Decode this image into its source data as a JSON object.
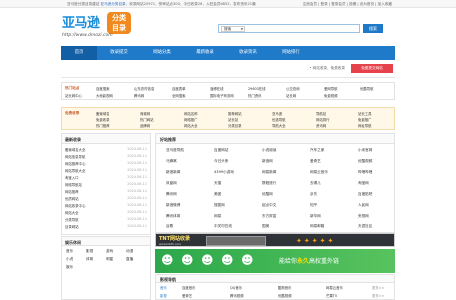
{
  "topbar": {
    "left_pre": "亚马逊分类目录建站",
    "left_hl": "亚马逊分类目录",
    "left_rest": "，收录网站20971，快审站点300，今日收录26，入驻会员6852，发布资讯21篇",
    "right": "注册会员 | 登录 | 登录会员 | 投稿 | 设为首页 | 加入收藏"
  },
  "logo": {
    "name": "亚马逊",
    "badge_top": "分类",
    "badge_bottom": "目录",
    "url": "http://www.dmozi.com"
  },
  "search": {
    "select_value": "搜索",
    "button_label": "搜索"
  },
  "nav": {
    "items": [
      {
        "label": "首页",
        "active": true
      },
      {
        "label": "收录提交",
        "active": false
      },
      {
        "label": "网站分类",
        "active": false
      },
      {
        "label": "最新收录",
        "active": false
      },
      {
        "label": "收录资讯",
        "active": false
      },
      {
        "label": "网站排行",
        "active": false
      }
    ]
  },
  "crumb": {
    "text": "• 网站收录，免费收录",
    "submit_label": "免费提交网站"
  },
  "box1": {
    "label": "热门站点",
    "rows": [
      [
        "百度搜索",
        "山东农村信息",
        "百度表单",
        "淄博在线",
        "29603在线",
        "公交查询",
        "爱网导航",
        "优酷导航"
      ],
      [
        "站长网中心",
        "大地影视网",
        "腾讯网",
        "全网搜索",
        "国际电子商务网",
        "热门资讯",
        "站长网",
        "免费视频"
      ]
    ]
  },
  "box2": {
    "label": "免费收录",
    "rows": [
      [
        "备案域名",
        "商城网",
        "网站名称",
        "推荐网站",
        "亚马逊",
        "导航站",
        "站长工具"
      ],
      [
        "免费收录",
        "热门网站",
        "网络推广",
        "站长站",
        "优选导航",
        "网站排行",
        "免费推广"
      ],
      [
        "热门推荐",
        "品牌网",
        "网站大全",
        "分类目录",
        "导航大全",
        "资讯网",
        "网址导航"
      ]
    ]
  },
  "sidebar": {
    "title": "最新收录",
    "rows": [
      {
        "name": "备案域名大全",
        "date": "2024-06-11"
      },
      {
        "name": "网站信息导航",
        "date": "2024-06-11"
      },
      {
        "name": "网站推荐中心",
        "date": "2024-06-11"
      },
      {
        "name": "网站导航大全",
        "date": "2024-06-11"
      },
      {
        "name": "淘宝入口",
        "date": "2024-06-11"
      },
      {
        "name": "网络导航站",
        "date": "2024-06-11"
      },
      {
        "name": "网站推荐",
        "date": "2024-06-11"
      },
      {
        "name": "优质网站",
        "date": "2024-06-11"
      },
      {
        "name": "网站收录中心",
        "date": "2024-06-11"
      },
      {
        "name": "网站大全",
        "date": "2024-06-11"
      },
      {
        "name": "分类导航",
        "date": "2024-06-11"
      },
      {
        "name": "目录网站",
        "date": "2024-06-11"
      }
    ]
  },
  "sidebar2": {
    "title": "娱乐休闲",
    "cats": [
      "音乐",
      "影视",
      "游戏",
      "动漫",
      "小说",
      "体育",
      "明星",
      "直播",
      "娱乐"
    ]
  },
  "mainbox": {
    "title": "好站推荐",
    "rows": [
      [
        "亚马逊导航",
        "百度网站",
        "小说阅读",
        "汽车之家",
        "小米官网"
      ],
      [
        "马蜂窝",
        "今日头条",
        "新浪网",
        "爱奇艺",
        "优酷视频"
      ],
      [
        "新浪新闻",
        "4399小游戏",
        "网易新闻",
        "网易云音乐",
        "哔哩哔哩"
      ],
      [
        "凤凰网",
        "天猫",
        "携程旅行",
        "去哪儿",
        "淘宝网"
      ],
      [
        "腾讯网",
        "美团",
        "优酷网",
        "京东",
        "百度贴吧"
      ],
      [
        "新浪微博",
        "搜狐网",
        "起点中文",
        "知乎",
        "人民网"
      ],
      [
        "腾讯体育",
        "网易",
        "东方财富",
        "新华网",
        "央视网"
      ],
      [
        "谷歌",
        "中关村在线",
        "国美",
        "网易邮箱",
        "天涯社区"
      ]
    ]
  },
  "banner1": {
    "title": "TNT网站收录",
    "sub": "www.tntdh.com"
  },
  "banner2": {
    "pre": "能给你",
    "highlight": "永久",
    "post": "高权重外链"
  },
  "famous": {
    "title": "影视导航",
    "rows": [
      {
        "cat": "音乐",
        "items": [
          "百度音乐",
          "QQ音乐",
          "酷狗音乐",
          "网易云音乐"
        ],
        "more": "更多>>"
      },
      {
        "cat": "影视",
        "items": [
          "爱奇艺",
          "腾讯视频",
          "优酷视频",
          "芒果TV"
        ],
        "more": "更多>>"
      }
    ]
  }
}
